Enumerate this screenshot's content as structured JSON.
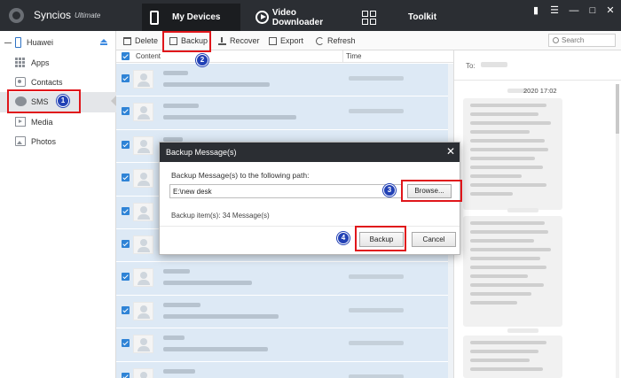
{
  "app": {
    "name": "Syncios",
    "edition": "Ultimate",
    "nav": [
      "My Devices",
      "Video Downloader",
      "Toolkit"
    ],
    "window_controls": [
      "message-icon",
      "menu-icon",
      "minimize-icon",
      "maximize-icon",
      "close-icon"
    ]
  },
  "sidebar": {
    "device": "Huawei",
    "items": [
      {
        "label": "Apps",
        "icon": "apps-icon"
      },
      {
        "label": "Contacts",
        "icon": "contacts-icon"
      },
      {
        "label": "SMS",
        "icon": "sms-icon",
        "selected": true
      },
      {
        "label": "Media",
        "icon": "media-icon"
      },
      {
        "label": "Photos",
        "icon": "photos-icon"
      }
    ]
  },
  "toolbar": {
    "delete": "Delete",
    "backup": "Backup",
    "recover": "Recover",
    "export": "Export",
    "refresh": "Refresh",
    "search_placeholder": "Search"
  },
  "list": {
    "col_content": "Content",
    "col_time": "Time",
    "row_count": 10
  },
  "preview": {
    "to_label": "To:",
    "time": "2020 17:02"
  },
  "dialog": {
    "title": "Backup Message(s)",
    "path_label": "Backup Message(s) to the following path:",
    "path_value": "E:\\new desk",
    "browse": "Browse...",
    "info": "Backup item(s): 34 Message(s)",
    "ok": "Backup",
    "cancel": "Cancel",
    "close_glyph": "✕"
  },
  "annotations": {
    "steps": [
      "1",
      "2",
      "3",
      "4"
    ],
    "color": "#e0161b",
    "badge_color": "#2241b5"
  },
  "colors": {
    "titlebar": "#2b2e33",
    "row_selected": "#dde9f5",
    "checkbox": "#2e83d6"
  }
}
